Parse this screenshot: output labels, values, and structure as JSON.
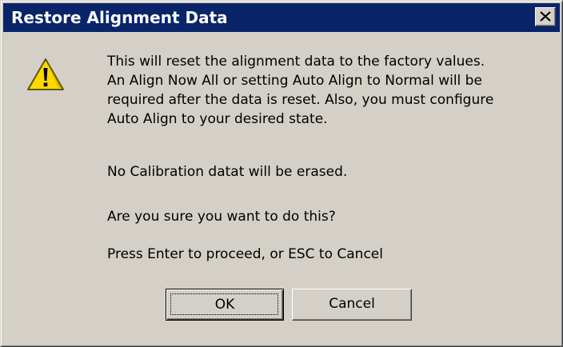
{
  "window": {
    "title": "Restore Alignment Data",
    "close_icon": "close-icon",
    "title_bar_color": "#0a246a"
  },
  "icon": {
    "name": "warning-icon",
    "color": "#ffd800"
  },
  "message": {
    "lines": [
      "This will reset the alignment data to the factory values.",
      "An Align Now All or setting Auto Align to Normal will be",
      "required after the data is reset.  Also, you must configure",
      "Auto Align to your desired state."
    ],
    "calibration_note": "No Calibration datat will be erased.",
    "confirm_question": "Are you sure you want to do this?",
    "instructions": "Press Enter to proceed, or ESC to Cancel"
  },
  "buttons": {
    "ok_label": "OK",
    "cancel_label": "Cancel"
  }
}
